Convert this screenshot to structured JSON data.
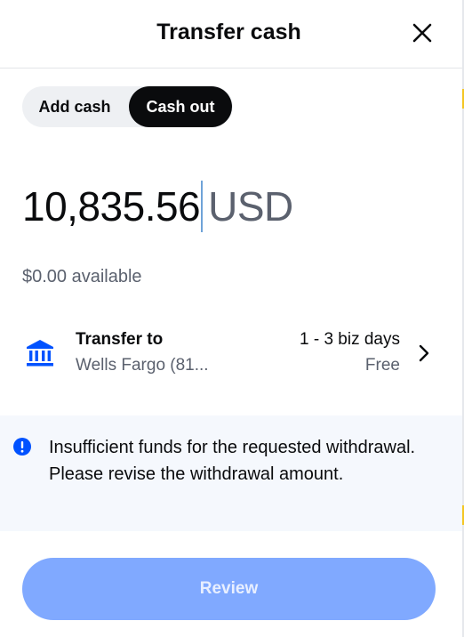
{
  "header": {
    "title": "Transfer cash",
    "close_icon": "close-icon"
  },
  "tabs": {
    "add_label": "Add cash",
    "out_label": "Cash out",
    "selected": "Cash out"
  },
  "amount": {
    "value": "10,835.56",
    "currency": "USD"
  },
  "available": "$0.00 available",
  "transfer": {
    "label": "Transfer to",
    "account": "Wells Fargo (81...",
    "speed": "1 - 3 biz days",
    "fee": "Free",
    "icon": "bank-icon"
  },
  "alert": {
    "icon": "alert-icon",
    "message": "Insufficient funds for the requested withdrawal. Please revise the withdrawal amount."
  },
  "review_label": "Review",
  "colors": {
    "primary_disabled": "#80a9ff",
    "brand_blue": "#0052ff",
    "alert_bg": "#f5f8fd",
    "text_primary": "#0a0b0d",
    "text_secondary": "#5b616e"
  }
}
